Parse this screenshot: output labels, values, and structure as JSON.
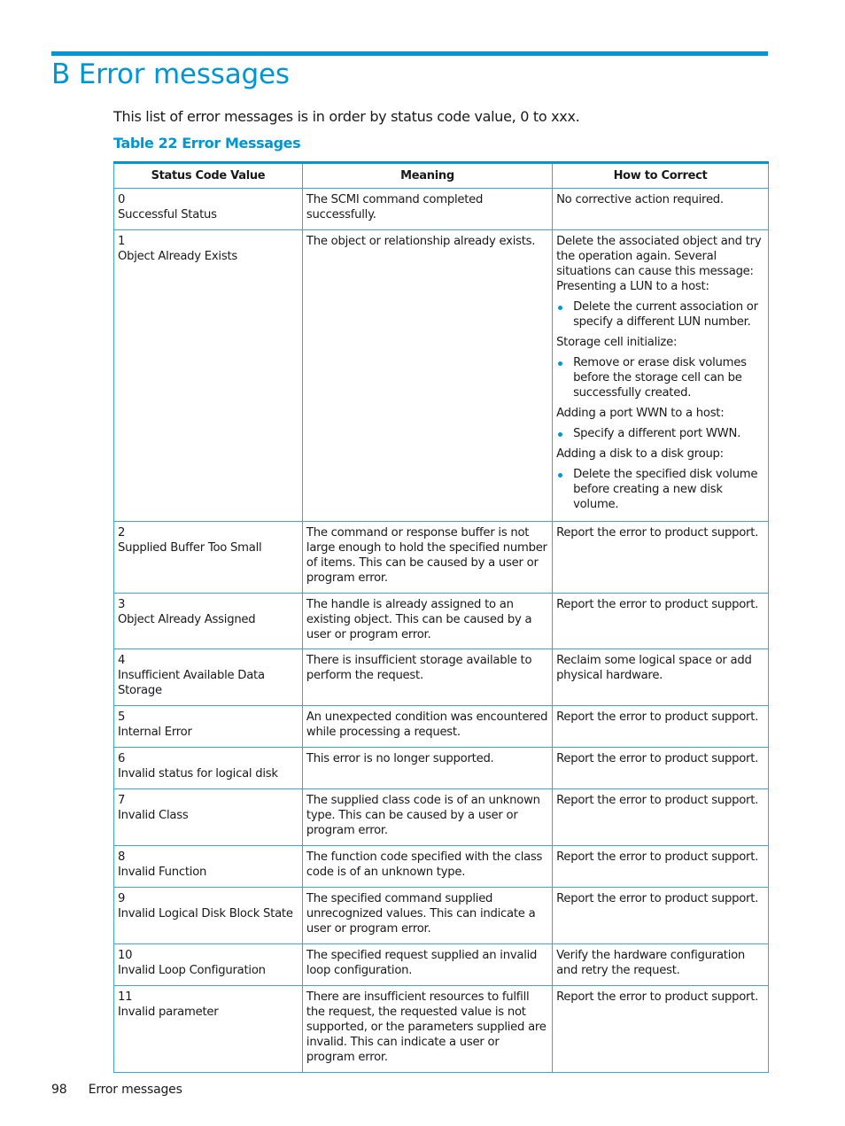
{
  "chapter": {
    "title": "B Error messages"
  },
  "intro": "This list of error messages is in order by status code value, 0 to xxx.",
  "table": {
    "caption": "Table 22 Error Messages",
    "headers": [
      "Status Code Value",
      "Meaning",
      "How to Correct"
    ],
    "rows": [
      {
        "code": "0",
        "name": "Successful Status",
        "meaning": "The SCMI command completed successfully.",
        "fix": "No corrective action required."
      },
      {
        "code": "1",
        "name": "Object Already Exists",
        "meaning": "The object or relationship already exists.",
        "fix_intro": "Delete the associated object and try the operation again. Several situations can cause this message:",
        "fix_groups": [
          {
            "label": "Presenting a LUN to a host:",
            "bullet": "Delete the current association or specify a different LUN number."
          },
          {
            "label": "Storage cell initialize:",
            "bullet": "Remove or erase disk volumes before the storage cell can be successfully created."
          },
          {
            "label": "Adding a port WWN to a host:",
            "bullet": "Specify a different port WWN."
          },
          {
            "label": "Adding a disk to a disk group:",
            "bullet": "Delete the specified disk volume before creating a new disk volume."
          }
        ]
      },
      {
        "code": "2",
        "name": "Supplied Buffer Too Small",
        "meaning": "The command or response buffer is not large enough to hold the specified number of items. This can be caused by a user or program error.",
        "fix": "Report the error to product support."
      },
      {
        "code": "3",
        "name": "Object Already Assigned",
        "meaning": "The handle is already assigned to an existing object. This can be caused by a user or program error.",
        "fix": "Report the error to product support."
      },
      {
        "code": "4",
        "name": "Insufficient Available Data Storage",
        "meaning": "There is insufficient storage available to perform the request.",
        "fix": "Reclaim some logical space or add physical hardware."
      },
      {
        "code": "5",
        "name": "Internal Error",
        "meaning": "An unexpected condition was encountered while processing a request.",
        "fix": "Report the error to product support."
      },
      {
        "code": "6",
        "name": "Invalid status for logical disk",
        "meaning": "This error is no longer supported.",
        "fix": "Report the error to product support."
      },
      {
        "code": "7",
        "name": "Invalid Class",
        "meaning": "The supplied class code is of an unknown type. This can be caused by a user or program error.",
        "fix": "Report the error to product support."
      },
      {
        "code": "8",
        "name": "Invalid Function",
        "meaning": "The function code specified with the class code is of an unknown type.",
        "fix": "Report the error to product support."
      },
      {
        "code": "9",
        "name": "Invalid Logical Disk Block State",
        "meaning": "The specified command supplied unrecognized values. This can indicate a user or program error.",
        "fix": "Report the error to product support."
      },
      {
        "code": "10",
        "name": "Invalid Loop Configuration",
        "meaning": "The specified request supplied an invalid loop configuration.",
        "fix": "Verify the hardware configuration and retry the request."
      },
      {
        "code": "11",
        "name": "Invalid parameter",
        "meaning": "There are insufficient resources to fulfill the request, the requested value is not supported, or the parameters supplied are invalid. This can indicate a user or program error.",
        "fix": "Report the error to product support."
      }
    ]
  },
  "footer": {
    "page_number": "98",
    "section": "Error messages"
  },
  "colors": {
    "accent": "#0096d6",
    "border": "#3aa6dc"
  }
}
